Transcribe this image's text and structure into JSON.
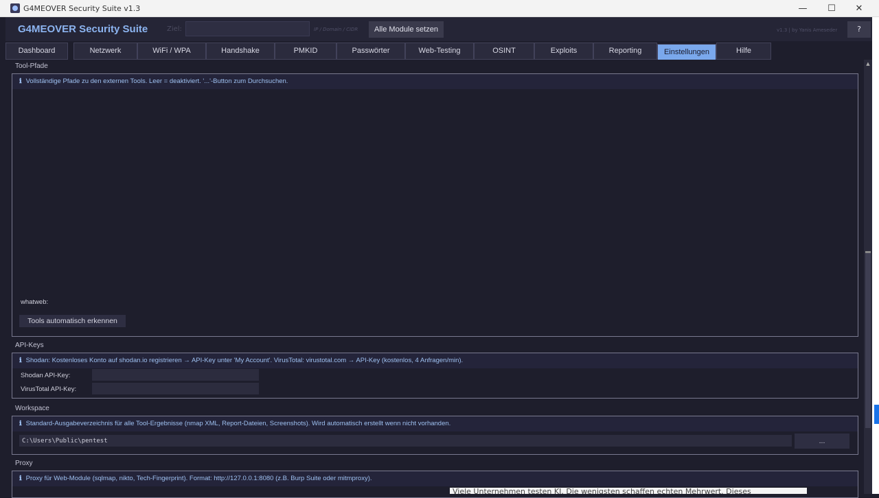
{
  "window": {
    "title": "G4MEOVER Security Suite  v1.3",
    "minimize": "—",
    "maximize": "☐",
    "close": "✕"
  },
  "header": {
    "logo": "G4MEOVER Security Suite",
    "ziel_label": "Ziel:",
    "ziel_value": "",
    "ziel_hint": "IP / Domain / CIDR",
    "set_all_button": "Alle Module setzen",
    "version": "v1.3  |  by Yanis Ameseder",
    "help_button": "?"
  },
  "tabs": [
    {
      "label": "Dashboard",
      "active": false
    },
    {
      "label": "Netzwerk",
      "active": false
    },
    {
      "label": "WiFi / WPA",
      "active": false
    },
    {
      "label": "Handshake",
      "active": false
    },
    {
      "label": "PMKID",
      "active": false
    },
    {
      "label": "Passwörter",
      "active": false
    },
    {
      "label": "Web-Testing",
      "active": false
    },
    {
      "label": "OSINT",
      "active": false
    },
    {
      "label": "Exploits",
      "active": false
    },
    {
      "label": "Reporting",
      "active": false
    },
    {
      "label": "Einstellungen",
      "active": true
    },
    {
      "label": "Hilfe",
      "active": false
    }
  ],
  "tool_paths": {
    "title": "Tool-Pfade",
    "info": "Vollständige Pfade zu den externen Tools. Leer = deaktiviert. '...'-Button zum Durchsuchen.",
    "whatweb_label": "whatweb:",
    "auto_detect_button": "Tools automatisch erkennen"
  },
  "api_keys": {
    "title": "API-Keys",
    "info": "Shodan: Kostenloses Konto auf shodan.io registrieren → API-Key unter 'My Account'. VirusTotal: virustotal.com → API-Key (kostenlos, 4 Anfragen/min).",
    "shodan_label": "Shodan API-Key:",
    "shodan_value": "",
    "virustotal_label": "VirusTotal API-Key:",
    "virustotal_value": ""
  },
  "workspace": {
    "title": "Workspace",
    "info": "Standard-Ausgabeverzeichnis für alle Tool-Ergebnisse (nmap XML, Report-Dateien, Screenshots). Wird automatisch erstellt wenn nicht vorhanden.",
    "path": "C:\\Users\\Public\\pentest",
    "browse_button": "..."
  },
  "proxy": {
    "title": "Proxy",
    "info": "Proxy für Web-Module (sqlmap, nikto, Tech-Fingerprint). Format: http://127.0.0.1:8080 (z.B. Burp Suite oder mitmproxy)."
  },
  "info_icon": "ℹ",
  "scroll_up": "▲",
  "background_text": "Viele Unternehmen testen KI. Die wenigsten schaffen echten Mehrwert. Dieses"
}
